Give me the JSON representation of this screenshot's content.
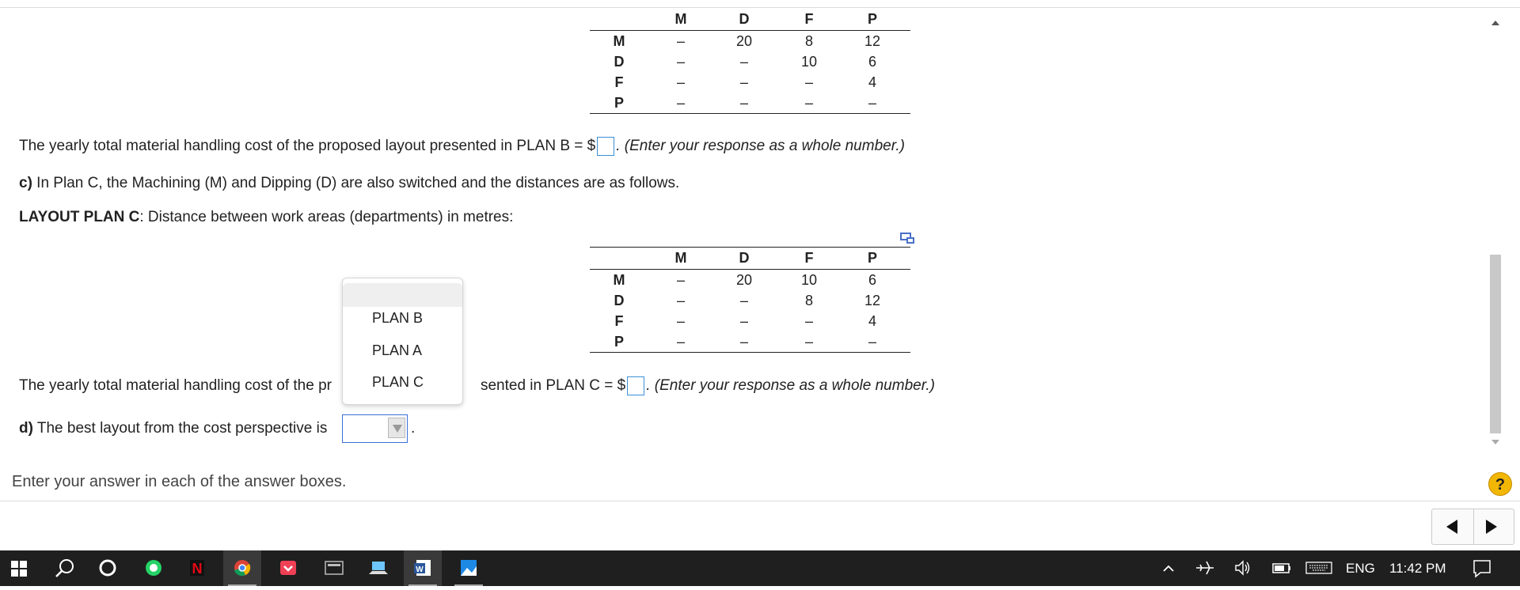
{
  "table_b": {
    "headers": [
      "",
      "M",
      "D",
      "F",
      "P"
    ],
    "rows": [
      [
        "M",
        "–",
        "20",
        "8",
        "12"
      ],
      [
        "D",
        "–",
        "–",
        "10",
        "6"
      ],
      [
        "F",
        "–",
        "–",
        "–",
        "4"
      ],
      [
        "P",
        "–",
        "–",
        "–",
        "–"
      ]
    ]
  },
  "text_b_prefix": "The yearly total material handling cost of the proposed layout presented in PLAN B = $",
  "text_b_suffix": ". (Enter your response as a whole number.)",
  "part_c": {
    "label": "c)",
    "text": " In Plan C, the Machining (M) and Dipping (D) are also switched and the distances are as follows."
  },
  "layout_c": {
    "label": "LAYOUT PLAN C",
    "text": ": Distance between work areas (departments) in metres:"
  },
  "table_c": {
    "headers": [
      "",
      "M",
      "D",
      "F",
      "P"
    ],
    "rows": [
      [
        "M",
        "–",
        "20",
        "10",
        "6"
      ],
      [
        "D",
        "–",
        "–",
        "8",
        "12"
      ],
      [
        "F",
        "–",
        "–",
        "–",
        "4"
      ],
      [
        "P",
        "–",
        "–",
        "–",
        "–"
      ]
    ]
  },
  "text_c_prefix": "The yearly total material handling cost of the pr",
  "text_c_middle": "sented in PLAN C = $",
  "text_c_suffix": ". (Enter your response as a whole number.)",
  "part_d": {
    "label": "d)",
    "text": " The best layout from the cost perspective is",
    "end": "."
  },
  "dropdown_options": [
    "PLAN B",
    "PLAN A",
    "PLAN C"
  ],
  "instruction": "Enter your answer in each of the answer boxes.",
  "help_label": "?",
  "taskbar": {
    "lang": "ENG",
    "time": "11:42 PM"
  }
}
